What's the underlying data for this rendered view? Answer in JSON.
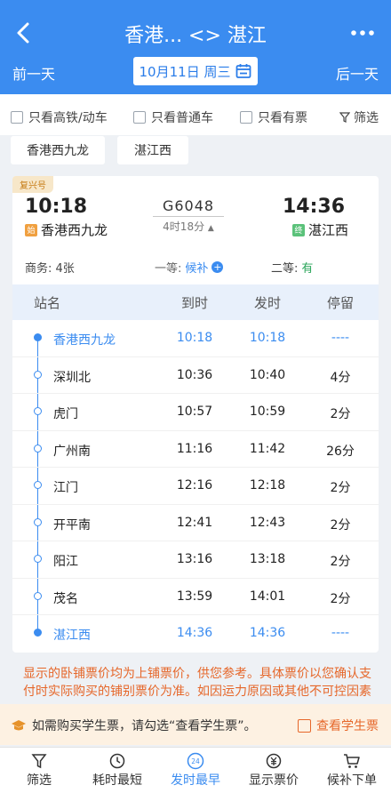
{
  "header": {
    "title": "香港... <> 湛江",
    "prev_day": "前一天",
    "next_day": "后一天",
    "date": "10月11日 周三"
  },
  "filters": {
    "high_speed_only": "只看高铁/动车",
    "normal_only": "只看普通车",
    "available_only": "只看有票",
    "filter_label": "筛选"
  },
  "station_chips": [
    "香港西九龙",
    "湛江西"
  ],
  "train": {
    "badge": "复兴号",
    "dep_time": "10:18",
    "arr_time": "14:36",
    "train_no": "G6048",
    "duration": "4时18分",
    "dep_station": "香港西九龙",
    "arr_station": "湛江西",
    "dep_tag": "始",
    "arr_tag": "终",
    "seats": {
      "business": "商务: 4张",
      "first_label": "一等:",
      "first_value": "候补",
      "second_label": "二等:",
      "second_value": "有"
    }
  },
  "table": {
    "headers": [
      "站名",
      "到时",
      "发时",
      "停留"
    ],
    "rows": [
      {
        "name": "香港西九龙",
        "arr": "10:18",
        "dep": "10:18",
        "stop": "----"
      },
      {
        "name": "深圳北",
        "arr": "10:36",
        "dep": "10:40",
        "stop": "4分"
      },
      {
        "name": "虎门",
        "arr": "10:57",
        "dep": "10:59",
        "stop": "2分"
      },
      {
        "name": "广州南",
        "arr": "11:16",
        "dep": "11:42",
        "stop": "26分"
      },
      {
        "name": "江门",
        "arr": "12:16",
        "dep": "12:18",
        "stop": "2分"
      },
      {
        "name": "开平南",
        "arr": "12:41",
        "dep": "12:43",
        "stop": "2分"
      },
      {
        "name": "阳江",
        "arr": "13:16",
        "dep": "13:18",
        "stop": "2分"
      },
      {
        "name": "茂名",
        "arr": "13:59",
        "dep": "14:01",
        "stop": "2分"
      },
      {
        "name": "湛江西",
        "arr": "14:36",
        "dep": "14:36",
        "stop": "----"
      }
    ]
  },
  "notice": "显示的卧铺票价均为上铺票价，供您参考。具体票价以您确认支付时实际购买的铺别票价为准。如因运力原因或其他不可控因素导致列车调度调整时，当前车型可能会发生变动。",
  "student": {
    "hint": "如需购买学生票，请勾选“查看学生票”。",
    "toggle": "查看学生票"
  },
  "bottom_nav": [
    {
      "label": "筛选",
      "icon": "filter-icon"
    },
    {
      "label": "耗时最短",
      "icon": "clock-icon"
    },
    {
      "label": "发时最早",
      "icon": "clock-24-icon"
    },
    {
      "label": "显示票价",
      "icon": "yuan-icon"
    },
    {
      "label": "候补下单",
      "icon": "cart-icon"
    }
  ],
  "colors": {
    "primary": "#3b8cf0",
    "accent_orange": "#e6672a",
    "seat_green": "#2aa55a"
  }
}
